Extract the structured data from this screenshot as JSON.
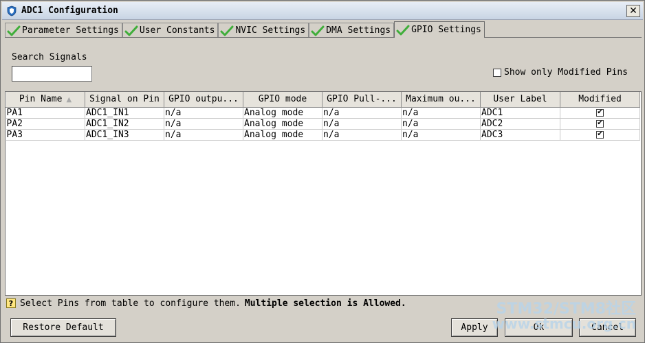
{
  "window": {
    "title": "ADC1 Configuration",
    "close_glyph": "✕"
  },
  "tabs": [
    {
      "label": "Parameter Settings",
      "icon": "green-check-icon"
    },
    {
      "label": "User Constants",
      "icon": "green-check-icon"
    },
    {
      "label": "NVIC Settings",
      "icon": "green-check-icon"
    },
    {
      "label": "DMA Settings",
      "icon": "green-check-icon"
    },
    {
      "label": "GPIO Settings",
      "icon": "green-check-icon",
      "active": true
    }
  ],
  "search": {
    "label": "Search Signals",
    "value": ""
  },
  "modified_filter": {
    "label": "Show only Modified Pins",
    "checked": false
  },
  "table": {
    "columns": [
      "Pin Name",
      "Signal on Pin",
      "GPIO outpu...",
      "GPIO mode",
      "GPIO Pull-...",
      "Maximum ou...",
      "User Label",
      "Modified"
    ],
    "sort_indicator": "▲",
    "rows": [
      [
        "PA1",
        "ADC1_IN1",
        "n/a",
        "Analog mode",
        "n/a",
        "n/a",
        "ADC1",
        "✔"
      ],
      [
        "PA2",
        "ADC1_IN2",
        "n/a",
        "Analog mode",
        "n/a",
        "n/a",
        "ADC2",
        "✔"
      ],
      [
        "PA3",
        "ADC1_IN3",
        "n/a",
        "Analog mode",
        "n/a",
        "n/a",
        "ADC3",
        "✔"
      ]
    ]
  },
  "hint": {
    "icon_glyph": "?",
    "text": "Select Pins from table to configure them.",
    "bold": "Multiple selection is Allowed."
  },
  "buttons": {
    "restore": "Restore Default",
    "apply": "Apply",
    "ok": "Ok",
    "cancel": "Cancel"
  },
  "watermark": {
    "line1": "STM32/STM8社区",
    "line2": "www.stmcu.org.cn"
  },
  "colors": {
    "check_green": "#3fae3a",
    "window_bg": "#d4d0c8",
    "watermark": "#b8d4ea"
  }
}
